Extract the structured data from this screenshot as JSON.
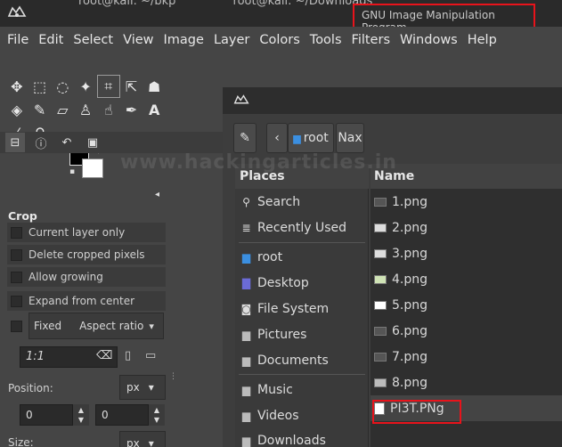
{
  "titlebar": {
    "tabs": [
      "root@kali: ~/bkp",
      "root@kali: ~/Downloads"
    ],
    "app_title": "GNU Image Manipulation Program"
  },
  "menubar": {
    "items": [
      "File",
      "Edit",
      "Select",
      "View",
      "Image",
      "Layer",
      "Colors",
      "Tools",
      "Filters",
      "Windows",
      "Help"
    ]
  },
  "tool_options": {
    "title": "Crop",
    "checkboxes": [
      "Current layer only",
      "Delete cropped pixels",
      "Allow growing",
      "Expand from center"
    ],
    "fixed": {
      "label": "Fixed",
      "value": "Aspect ratio"
    },
    "ratio_value": "1:1",
    "position_label": "Position:",
    "position_unit": "px",
    "position_x": "0",
    "position_y": "0",
    "size_label": "Size:",
    "size_unit": "px"
  },
  "dialog": {
    "path_buttons": [
      "root",
      "Nax"
    ],
    "places_header": "Places",
    "places": [
      "Search",
      "Recently Used",
      "root",
      "Desktop",
      "File System",
      "Pictures",
      "Documents",
      "Music",
      "Videos",
      "Downloads"
    ],
    "files_header": "Name",
    "files": [
      "1.png",
      "2.png",
      "3.png",
      "4.png",
      "5.png",
      "6.png",
      "7.png",
      "8.png",
      "PI3T.PNg"
    ]
  },
  "watermark": "www.hackingarticles.in",
  "colors": {
    "highlight": "#e8131b",
    "fg": "#000000",
    "bg": "#ffffff"
  }
}
